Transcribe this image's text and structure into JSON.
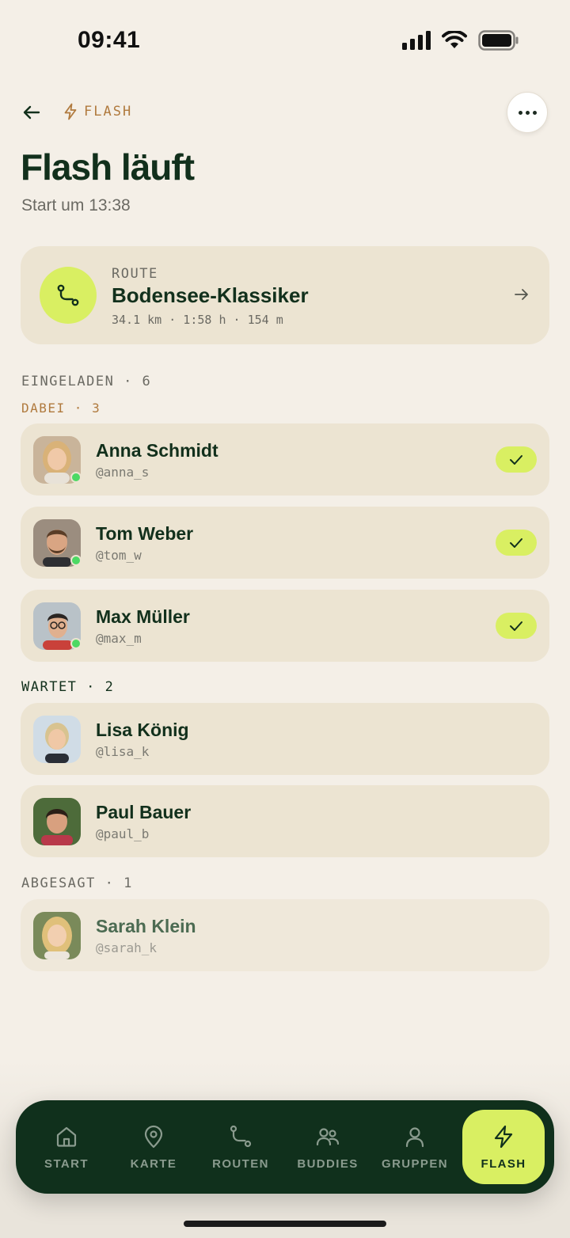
{
  "status_bar": {
    "time": "09:41"
  },
  "header": {
    "tag": "FLASH",
    "title": "Flash läuft",
    "subtitle": "Start um 13:38"
  },
  "route": {
    "label": "ROUTE",
    "name": "Bodensee-Klassiker",
    "meta": "34.1 km · 1:58 h · 154 m"
  },
  "sections": {
    "invited": "EINGELADEN · 6",
    "joined": "DABEI · 3",
    "waiting": "WARTET · 2",
    "declined": "ABGESAGT · 1"
  },
  "joined": [
    {
      "name": "Anna Schmidt",
      "handle": "@anna_s",
      "avatar_bg": "#c9b49a",
      "hair": "#d9b278",
      "online": true
    },
    {
      "name": "Tom Weber",
      "handle": "@tom_w",
      "avatar_bg": "#9b8d7f",
      "hair": "#5a3d27",
      "online": true
    },
    {
      "name": "Max Müller",
      "handle": "@max_m",
      "avatar_bg": "#b9c2c8",
      "hair": "#2a2522",
      "online": true
    }
  ],
  "waiting": [
    {
      "name": "Lisa König",
      "handle": "@lisa_k",
      "avatar_bg": "#d0dce6",
      "hair": "#d8c390"
    },
    {
      "name": "Paul Bauer",
      "handle": "@paul_b",
      "avatar_bg": "#4d6b3a",
      "hair": "#2b1f17"
    }
  ],
  "declined": [
    {
      "name": "Sarah Klein",
      "handle": "@sarah_k",
      "avatar_bg": "#7a8a5a",
      "hair": "#e0c07a"
    }
  ],
  "nav": {
    "items": [
      {
        "label": "START",
        "icon": "home-icon"
      },
      {
        "label": "KARTE",
        "icon": "map-pin-icon"
      },
      {
        "label": "ROUTEN",
        "icon": "route-icon"
      },
      {
        "label": "BUDDIES",
        "icon": "buddies-icon"
      },
      {
        "label": "GRUPPEN",
        "icon": "person-icon"
      },
      {
        "label": "FLASH",
        "icon": "flash-icon",
        "active": true
      }
    ]
  },
  "colors": {
    "accent": "#d9ef62",
    "dark": "#10301c",
    "card": "#ece4d2",
    "background": "#f4efe7",
    "tag": "#b07a3e"
  }
}
